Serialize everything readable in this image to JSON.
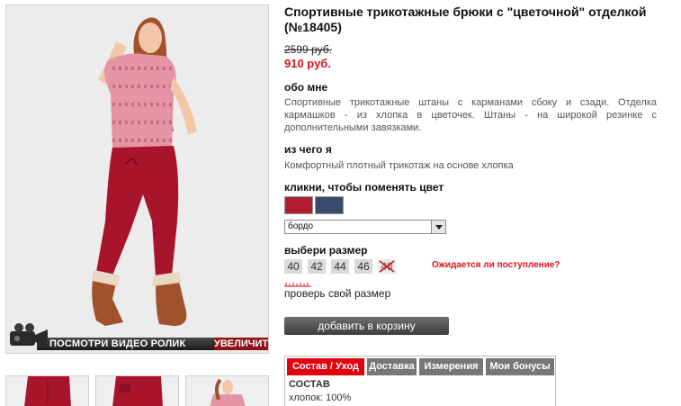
{
  "product": {
    "title": "Спортивные трикотажные брюки с \"цветочной\" отделкой (№18405)",
    "old_price": "2599 руб.",
    "new_price": "910 руб."
  },
  "photo": {
    "video_label": "ПОСМОТРИ ВИДЕО РОЛИК",
    "zoom_label": "УВЕЛИЧИТЬ"
  },
  "about": {
    "heading": "обо мне",
    "text": "Спортивные трикотажные штаны с карманами сбоку и сзади. Отделка кармашков - из хлопка в цветочек. Штаны - на широкой резинке с дополнительными завязками."
  },
  "material": {
    "heading": "из чего я",
    "text": "Комфортный плотный трикотаж на основе хлопка"
  },
  "color": {
    "heading": "кликни, чтобы поменять цвет",
    "selected": "бордо"
  },
  "size": {
    "heading": "выбери размер",
    "options": [
      "40",
      "42",
      "44",
      "46",
      "48"
    ],
    "waiting_link": "Ожидается ли поступление?",
    "check_link": "проверь свой размер"
  },
  "cart": {
    "button_label": "добавить в корзину"
  },
  "tabs": {
    "items": [
      "Состав / Уход",
      "Доставка",
      "Измерения",
      "Мои бонусы"
    ],
    "content_heading": "СОСТАВ",
    "content_text": "хлопок: 100%"
  },
  "colors": {
    "accent_red": "#d9131b",
    "tab_active": "#e3000f",
    "tab_inactive": "#777777",
    "button": "#4a4a4a",
    "swatch_bordo": "#b01d33",
    "swatch_navy": "#3a4a6b"
  }
}
